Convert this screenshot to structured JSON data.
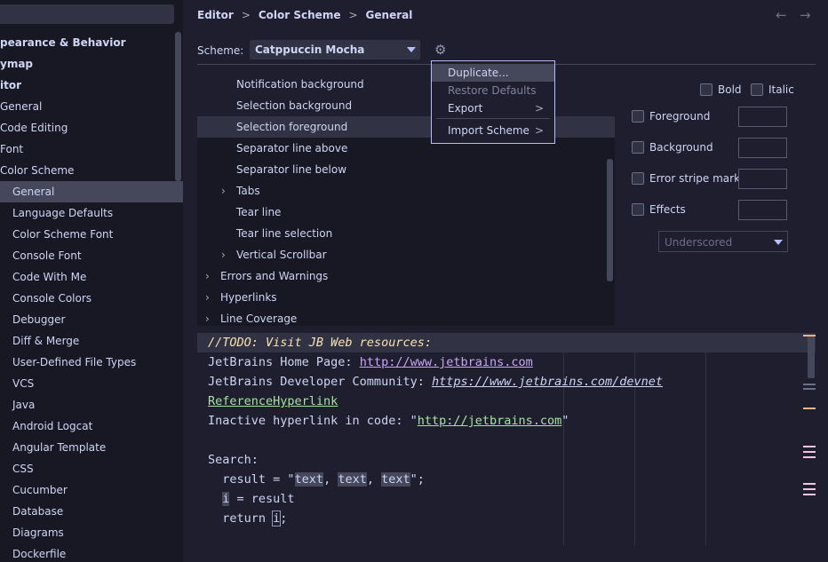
{
  "sidebar": {
    "items": [
      {
        "label": "pearance & Behavior",
        "indent": -5,
        "bold": true,
        "selected": false
      },
      {
        "label": "ymap",
        "indent": -4,
        "bold": true,
        "selected": false
      },
      {
        "label": "itor",
        "indent": -3,
        "bold": true,
        "selected": false
      },
      {
        "label": "General",
        "indent": 0,
        "bold": false,
        "selected": false
      },
      {
        "label": "Code Editing",
        "indent": 0,
        "bold": false,
        "selected": false
      },
      {
        "label": "Font",
        "indent": -1,
        "bold": false,
        "selected": false
      },
      {
        "label": "Color Scheme",
        "indent": 0,
        "bold": false,
        "selected": false
      },
      {
        "label": "General",
        "indent": 14,
        "bold": false,
        "selected": true
      },
      {
        "label": "Language Defaults",
        "indent": 14,
        "bold": false,
        "selected": false
      },
      {
        "label": "Color Scheme Font",
        "indent": 14,
        "bold": false,
        "selected": false
      },
      {
        "label": "Console Font",
        "indent": 14,
        "bold": false,
        "selected": false
      },
      {
        "label": "Code With Me",
        "indent": 14,
        "bold": false,
        "selected": false
      },
      {
        "label": "Console Colors",
        "indent": 14,
        "bold": false,
        "selected": false
      },
      {
        "label": "Debugger",
        "indent": 14,
        "bold": false,
        "selected": false
      },
      {
        "label": "Diff & Merge",
        "indent": 14,
        "bold": false,
        "selected": false
      },
      {
        "label": "User-Defined File Types",
        "indent": 14,
        "bold": false,
        "selected": false
      },
      {
        "label": "VCS",
        "indent": 14,
        "bold": false,
        "selected": false
      },
      {
        "label": "Java",
        "indent": 14,
        "bold": false,
        "selected": false
      },
      {
        "label": "Android Logcat",
        "indent": 14,
        "bold": false,
        "selected": false
      },
      {
        "label": "Angular Template",
        "indent": 14,
        "bold": false,
        "selected": false
      },
      {
        "label": "CSS",
        "indent": 14,
        "bold": false,
        "selected": false
      },
      {
        "label": "Cucumber",
        "indent": 14,
        "bold": false,
        "selected": false
      },
      {
        "label": "Database",
        "indent": 14,
        "bold": false,
        "selected": false
      },
      {
        "label": "Diagrams",
        "indent": 14,
        "bold": false,
        "selected": false
      },
      {
        "label": "Dockerfile",
        "indent": 14,
        "bold": false,
        "selected": false
      }
    ]
  },
  "breadcrumb": {
    "c1": "Editor",
    "sep": ">",
    "c2": "Color Scheme",
    "c3": "General"
  },
  "nav": {
    "back": "←",
    "forward": "→"
  },
  "scheme": {
    "label": "Scheme:",
    "value": "Catppuccin Mocha",
    "gear": "⚙"
  },
  "menu": {
    "duplicate": "Duplicate...",
    "restore": "Restore Defaults",
    "export": "Export",
    "import": "Import Scheme",
    "arrow": ">"
  },
  "tree": {
    "rows": [
      {
        "label": "Notification background",
        "indent": 44,
        "chevron": false,
        "style": "alt"
      },
      {
        "label": "Selection background",
        "indent": 44,
        "chevron": false,
        "style": "alt"
      },
      {
        "label": "Selection foreground",
        "indent": 44,
        "chevron": false,
        "style": "sel"
      },
      {
        "label": "Separator line above",
        "indent": 44,
        "chevron": false,
        "style": ""
      },
      {
        "label": "Separator line below",
        "indent": 44,
        "chevron": false,
        "style": ""
      },
      {
        "label": "Tabs",
        "indent": 44,
        "chevron": true,
        "style": ""
      },
      {
        "label": "Tear line",
        "indent": 44,
        "chevron": false,
        "style": ""
      },
      {
        "label": "Tear line selection",
        "indent": 44,
        "chevron": false,
        "style": ""
      },
      {
        "label": "Vertical Scrollbar",
        "indent": 44,
        "chevron": true,
        "style": ""
      },
      {
        "label": "Errors and Warnings",
        "indent": 26,
        "chevron": true,
        "style": ""
      },
      {
        "label": "Hyperlinks",
        "indent": 26,
        "chevron": true,
        "style": ""
      },
      {
        "label": "Line Coverage",
        "indent": 26,
        "chevron": true,
        "style": ""
      }
    ],
    "chevron_glyph": "›"
  },
  "attributes": {
    "bold": "Bold",
    "italic": "Italic",
    "foreground": "Foreground",
    "background": "Background",
    "error_stripe": "Error stripe mark",
    "effects": "Effects",
    "effects_type": "Underscored"
  },
  "preview": {
    "todo": "//TODO: Visit JB Web resources:",
    "home_label": "JetBrains Home Page: ",
    "home_url": "http://www.jetbrains.com",
    "dev_label": "JetBrains Developer Community: ",
    "dev_url": "https://www.jetbrains.com/devnet",
    "ref": "ReferenceHyperlink",
    "inactive_label": "Inactive hyperlink in code: \"",
    "inactive_url": "http://jetbrains.com",
    "inactive_end": "\"",
    "search": "Search:",
    "result_pre": "  result = \"",
    "text": "text",
    "comma": ", ",
    "result_post": "\";",
    "i_line_pre": "  ",
    "i": "i",
    "i_line_post": " = result",
    "return_pre": "  return ",
    "return_post": ";"
  },
  "colors": {
    "accent": "#b4befe",
    "background": "#1e1e2e",
    "sidebar": "#181825",
    "selection": "#45475a",
    "todo": "#f9e2af",
    "link": "#cba6f7",
    "ref": "#a6e3a1",
    "marker_pink": "#f5c2e7",
    "marker_peach": "#fab387"
  }
}
